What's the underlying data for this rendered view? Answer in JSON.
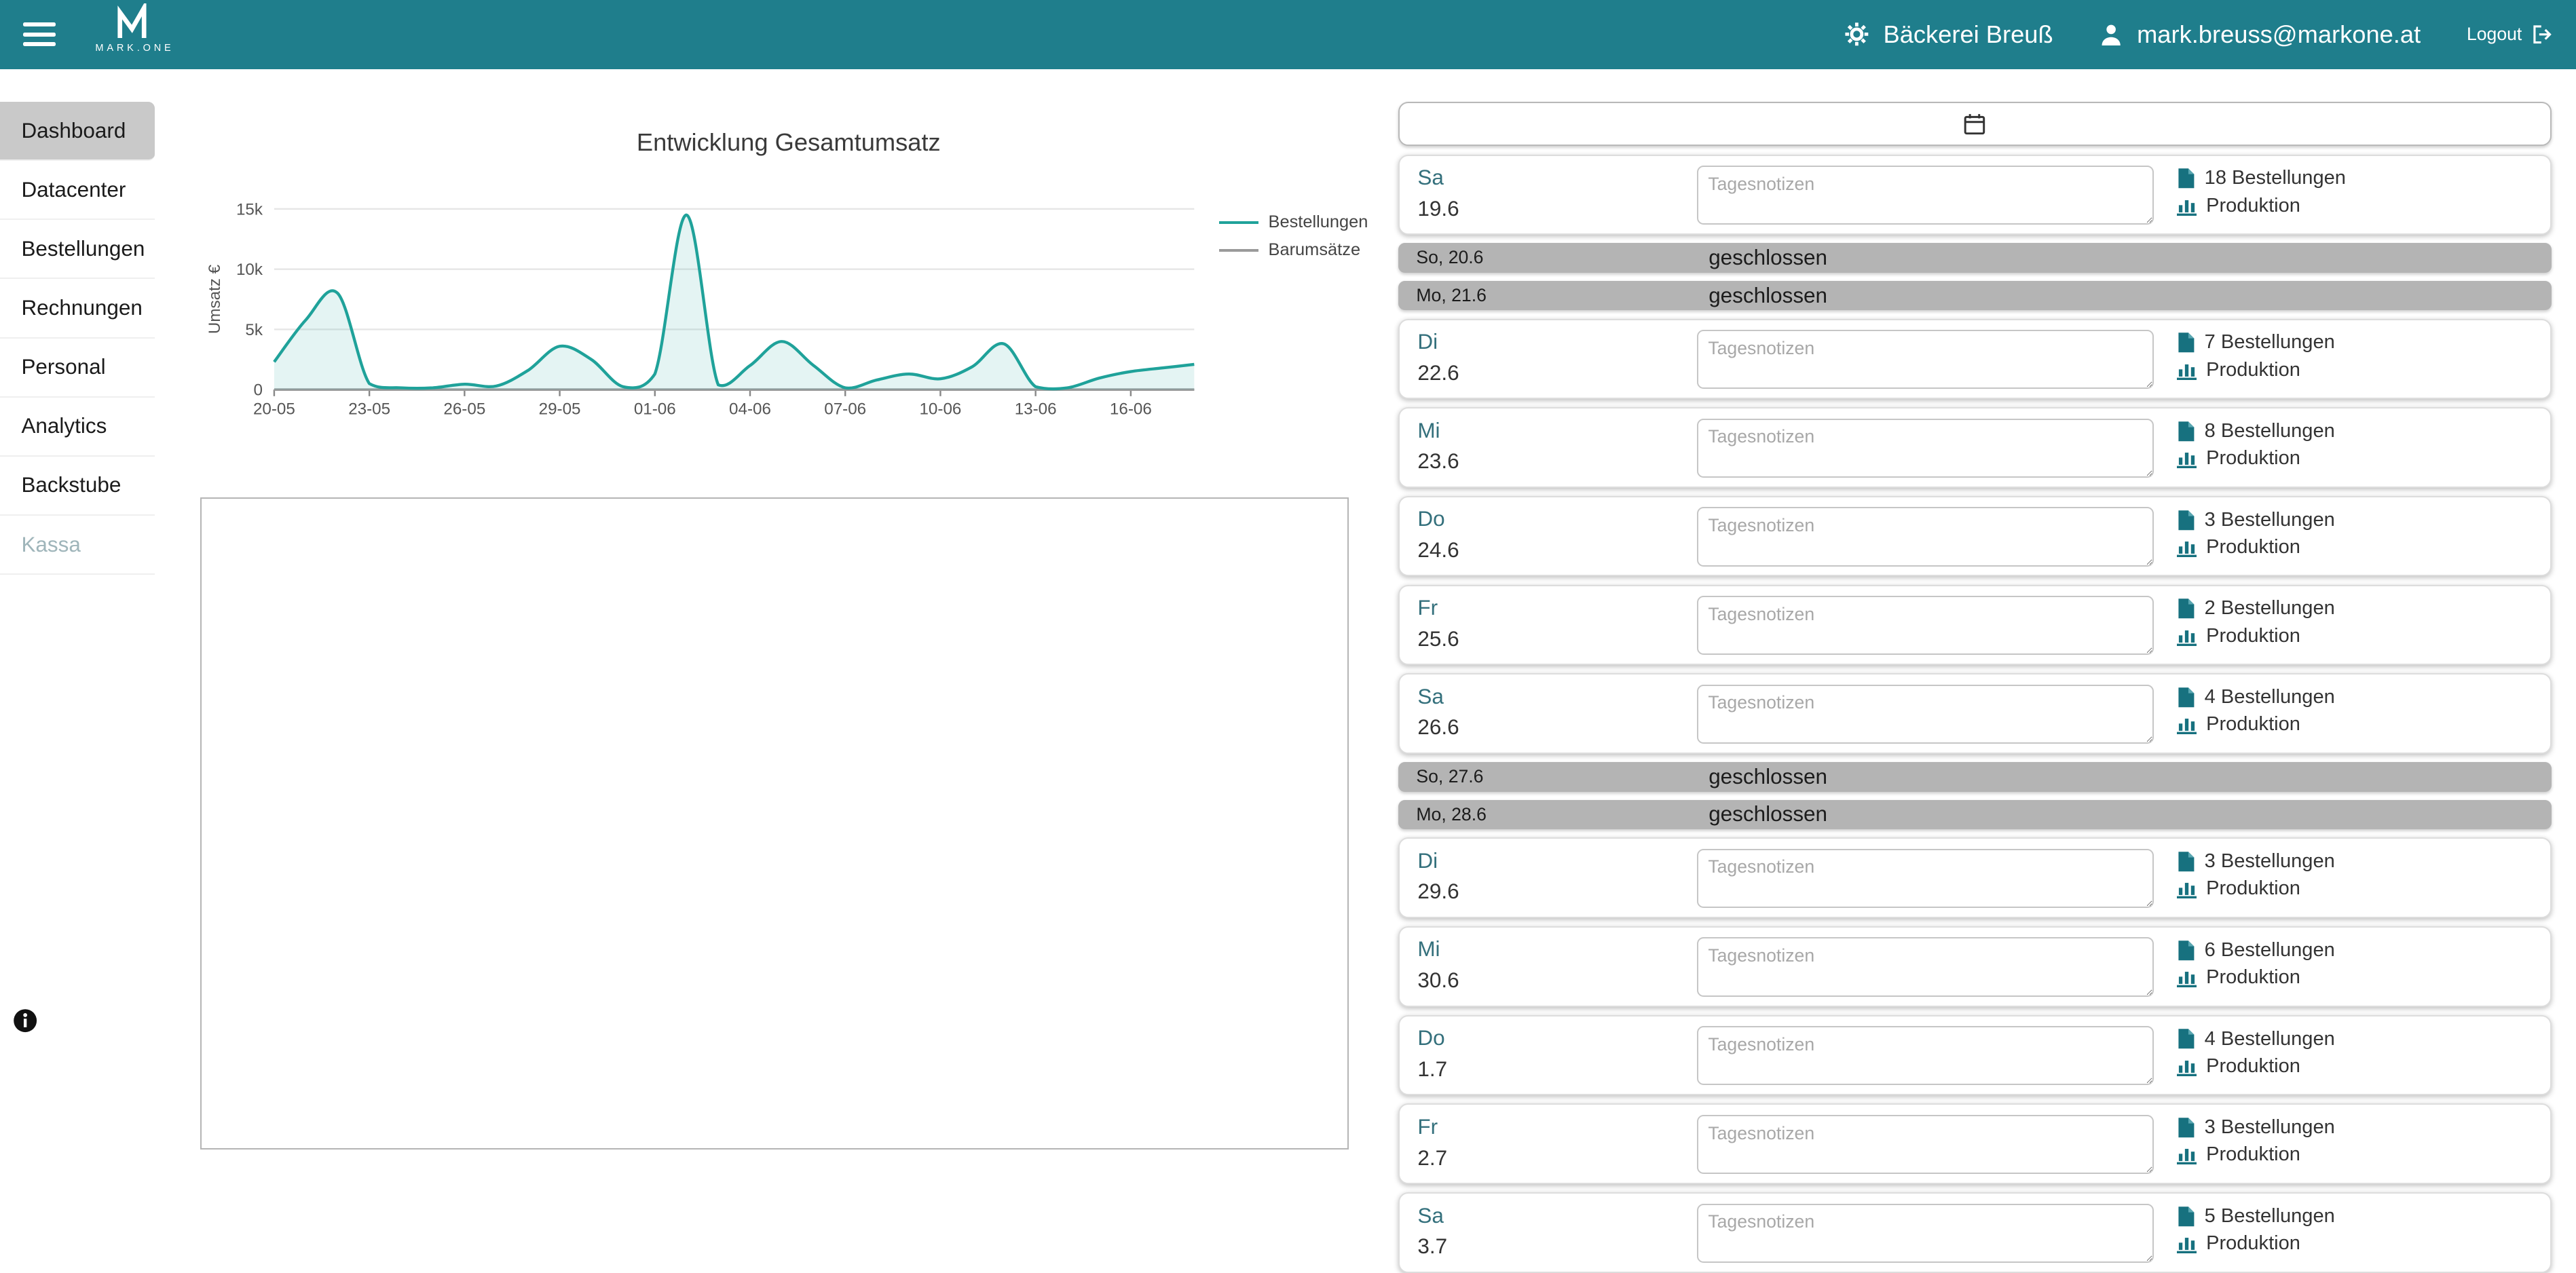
{
  "navbar": {
    "brand_text": "MARK.ONE",
    "company": "Bäckerei Breuß",
    "email": "mark.breuss@markone.at",
    "logout": "Logout",
    "color": "#1f7e8c"
  },
  "sidebar": {
    "items": [
      {
        "label": "Dashboard",
        "state": "active"
      },
      {
        "label": "Datacenter",
        "state": "normal"
      },
      {
        "label": "Bestellungen",
        "state": "normal"
      },
      {
        "label": "Rechnungen",
        "state": "normal"
      },
      {
        "label": "Personal",
        "state": "normal"
      },
      {
        "label": "Analytics",
        "state": "normal"
      },
      {
        "label": "Backstube",
        "state": "normal"
      },
      {
        "label": "Kassa",
        "state": "disabled"
      }
    ]
  },
  "chart_data": {
    "type": "line",
    "title": "Entwicklung Gesamtumsatz",
    "ylabel": "Umsatz €",
    "xlabel": "",
    "ylim": [
      0,
      15000
    ],
    "y_ticks": [
      "0",
      "5k",
      "10k",
      "15k"
    ],
    "y_tick_values": [
      0,
      5000,
      10000,
      15000
    ],
    "tick_every": 3,
    "grid": true,
    "legend_position": "right",
    "categories": [
      "20-05",
      "21-05",
      "22-05",
      "23-05",
      "24-05",
      "25-05",
      "26-05",
      "27-05",
      "28-05",
      "29-05",
      "30-05",
      "31-05",
      "01-06",
      "02-06",
      "03-06",
      "04-06",
      "05-06",
      "06-06",
      "07-06",
      "08-06",
      "09-06",
      "10-06",
      "11-06",
      "12-06",
      "13-06",
      "14-06",
      "15-06",
      "16-06",
      "17-06",
      "18-06"
    ],
    "series": [
      {
        "name": "Bestellungen",
        "color": "#1fa29a",
        "fill": "rgba(31,162,154,0.12)",
        "values": [
          2300,
          5800,
          8000,
          500,
          150,
          150,
          450,
          300,
          1600,
          3600,
          2500,
          250,
          1300,
          14500,
          400,
          2000,
          4000,
          2000,
          150,
          800,
          1300,
          900,
          1900,
          3800,
          250,
          150,
          950,
          1500,
          1800,
          2100
        ]
      },
      {
        "name": "Barumsätze",
        "color": "#9a9a9a",
        "fill": "none",
        "values": [
          0,
          0,
          0,
          0,
          0,
          0,
          0,
          0,
          0,
          0,
          0,
          0,
          0,
          0,
          0,
          0,
          0,
          0,
          0,
          0,
          0,
          0,
          0,
          0,
          0,
          0,
          0,
          0,
          0,
          0
        ]
      }
    ]
  },
  "day_list": {
    "notes_placeholder": "Tagesnotizen",
    "closed_label": "geschlossen",
    "produktion_label": "Produktion",
    "days": [
      {
        "type": "open",
        "day": "Sa",
        "date": "19.6",
        "orders": "18 Bestellungen"
      },
      {
        "type": "closed",
        "label": "So, 20.6"
      },
      {
        "type": "closed",
        "label": "Mo, 21.6"
      },
      {
        "type": "open",
        "day": "Di",
        "date": "22.6",
        "orders": "7 Bestellungen"
      },
      {
        "type": "open",
        "day": "Mi",
        "date": "23.6",
        "orders": "8 Bestellungen"
      },
      {
        "type": "open",
        "day": "Do",
        "date": "24.6",
        "orders": "3 Bestellungen"
      },
      {
        "type": "open",
        "day": "Fr",
        "date": "25.6",
        "orders": "2 Bestellungen"
      },
      {
        "type": "open",
        "day": "Sa",
        "date": "26.6",
        "orders": "4 Bestellungen"
      },
      {
        "type": "closed",
        "label": "So, 27.6"
      },
      {
        "type": "closed",
        "label": "Mo, 28.6"
      },
      {
        "type": "open",
        "day": "Di",
        "date": "29.6",
        "orders": "3 Bestellungen"
      },
      {
        "type": "open",
        "day": "Mi",
        "date": "30.6",
        "orders": "6 Bestellungen"
      },
      {
        "type": "open",
        "day": "Do",
        "date": "1.7",
        "orders": "4 Bestellungen"
      },
      {
        "type": "open",
        "day": "Fr",
        "date": "2.7",
        "orders": "3 Bestellungen"
      },
      {
        "type": "open",
        "day": "Sa",
        "date": "3.7",
        "orders": "5 Bestellungen"
      }
    ]
  }
}
